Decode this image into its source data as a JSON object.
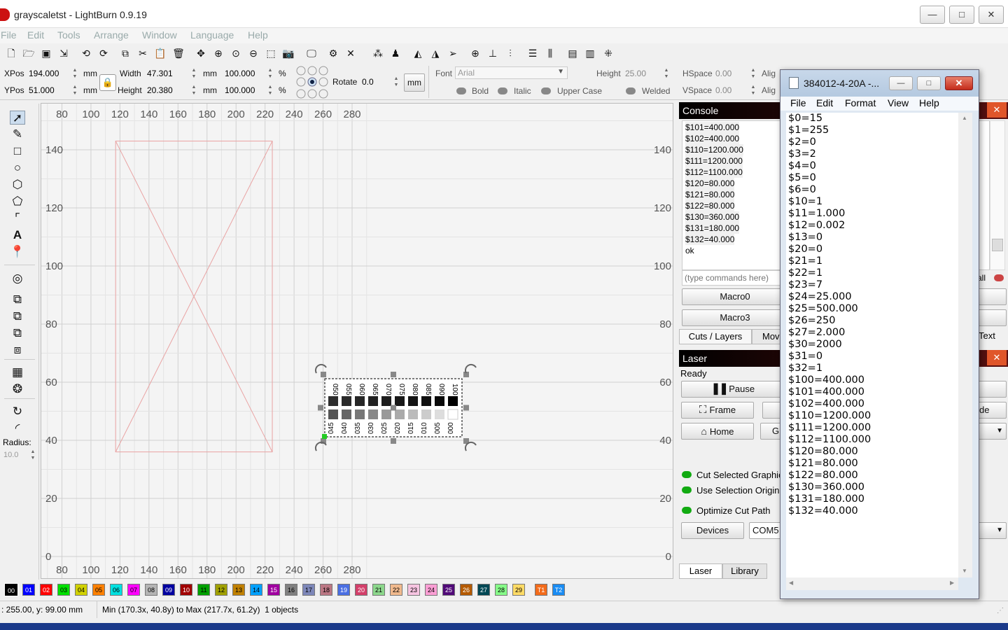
{
  "window": {
    "title": "grayscaletst - LightBurn 0.9.19",
    "min": "—",
    "max": "□",
    "close": "✕"
  },
  "menu": [
    "File",
    "Edit",
    "Tools",
    "Arrange",
    "Window",
    "Language",
    "Help"
  ],
  "props": {
    "xpos_label": "XPos",
    "xpos": "194.000",
    "ypos_label": "YPos",
    "ypos": "51.000",
    "unit": "mm",
    "width_label": "Width",
    "width": "47.301",
    "height_label": "Height",
    "height": "20.380",
    "scale_w": "100.000",
    "scale_h": "100.000",
    "pct": "%",
    "rotate_label": "Rotate",
    "rotate": "0.0",
    "mm_btn": "mm",
    "font_label": "Font",
    "font": "Arial",
    "fheight_label": "Height",
    "fheight": "25.00",
    "hspace_label": "HSpace",
    "hspace": "0.00",
    "vspace_label": "VSpace",
    "vspace": "0.00",
    "align1": "Alig",
    "align2": "Alig",
    "bold": "Bold",
    "italic": "Italic",
    "upper": "Upper Case",
    "welded": "Welded"
  },
  "left": {
    "radius_label": "Radius:",
    "radius": "10.0"
  },
  "canvas": {
    "xticks": [
      80,
      100,
      120,
      140,
      160,
      180,
      200,
      220,
      240,
      260,
      280
    ],
    "yticks": [
      140,
      120,
      100,
      80,
      60,
      40,
      20,
      0
    ],
    "test_top": [
      "050",
      "055",
      "060",
      "065",
      "070",
      "075",
      "080",
      "085",
      "090",
      "100"
    ],
    "test_bot": [
      "045",
      "040",
      "035",
      "030",
      "025",
      "020",
      "015",
      "010",
      "005",
      "000"
    ],
    "top_shades": [
      "#2e2e2e",
      "#2a2a2a",
      "#262626",
      "#222",
      "#1d1d1d",
      "#181818",
      "#141414",
      "#101010",
      "#0a0a0a",
      "#000"
    ],
    "bot_shades": [
      "#555",
      "#666",
      "#777",
      "#888",
      "#999",
      "#aaa",
      "#bbb",
      "#ccc",
      "#ddd",
      "#fff"
    ]
  },
  "console": {
    "title": "Console",
    "lines": [
      "$101=400.000",
      "$102=400.000",
      "$110=1200.000",
      "$111=1200.000",
      "$112=1100.000",
      "$120=80.000",
      "$121=80.000",
      "$122=80.000",
      "$130=360.000",
      "$131=180.000",
      "$132=40.000",
      "ok"
    ],
    "placeholder": "(type commands here)",
    "all": "all",
    "macro0": "Macro0",
    "macro3": "Macro3",
    "tab_cuts": "Cuts / Layers",
    "tab_move": "Mov",
    "tab_text": "Text"
  },
  "laser": {
    "title": "Laser",
    "status": "Ready",
    "pause": "Pause",
    "frame": "Frame",
    "home": "Home",
    "go": "G",
    "de": "de",
    "cut_selected": "Cut Selected Graphic",
    "use_origin": "Use Selection Origin",
    "optimize": "Optimize Cut Path",
    "devices": "Devices",
    "port": "COM5",
    "tab_laser": "Laser",
    "tab_library": "Library"
  },
  "palette": [
    "00",
    "01",
    "02",
    "03",
    "04",
    "05",
    "06",
    "07",
    "08",
    "09",
    "10",
    "11",
    "12",
    "13",
    "14",
    "15",
    "16",
    "17",
    "18",
    "19",
    "20",
    "21",
    "22",
    "23",
    "24",
    "25",
    "26",
    "27",
    "28",
    "29",
    "T1",
    "T2"
  ],
  "palette_colors": [
    "#000",
    "#0000ff",
    "#ff0000",
    "#00e000",
    "#d0d000",
    "#ff8000",
    "#00e0e0",
    "#ff00ff",
    "#b4b4b4",
    "#0000a0",
    "#a00000",
    "#00a000",
    "#a0a000",
    "#c08000",
    "#00a0ff",
    "#a000a0",
    "#808080",
    "#7d87b9",
    "#bb7784",
    "#4a6fe3",
    "#d33f6a",
    "#8cd78c",
    "#f0b98d",
    "#f6c4e1",
    "#fa9ed4",
    "#500a78",
    "#b45a00",
    "#004754",
    "#86fa88",
    "#ffdb66",
    "#f36b1a",
    "#1a8cf3"
  ],
  "status": {
    "coords": ": 255.00, y: 99.00 mm",
    "bounds": "Min (170.3x, 40.8y) to Max (217.7x, 61.2y)  1 objects"
  },
  "notepad": {
    "title": "384012-4-20A -...",
    "menu": [
      "File",
      "Edit",
      "Format",
      "View",
      "Help"
    ],
    "lines": [
      "$0=15",
      "$1=255",
      "$2=0",
      "$3=2",
      "$4=0",
      "$5=0",
      "$6=0",
      "$10=1",
      "$11=1.000",
      "$12=0.002",
      "$13=0",
      "$20=0",
      "$21=1",
      "$22=1",
      "$23=7",
      "$24=25.000",
      "$25=500.000",
      "$26=250",
      "$27=2.000",
      "$30=2000",
      "$31=0",
      "$32=1",
      "$100=400.000",
      "$101=400.000",
      "$102=400.000",
      "$110=1200.000",
      "$111=1200.000",
      "$112=1100.000",
      "$120=80.000",
      "$121=80.000",
      "$122=80.000",
      "$130=360.000",
      "$131=180.000",
      "$132=40.000"
    ]
  }
}
